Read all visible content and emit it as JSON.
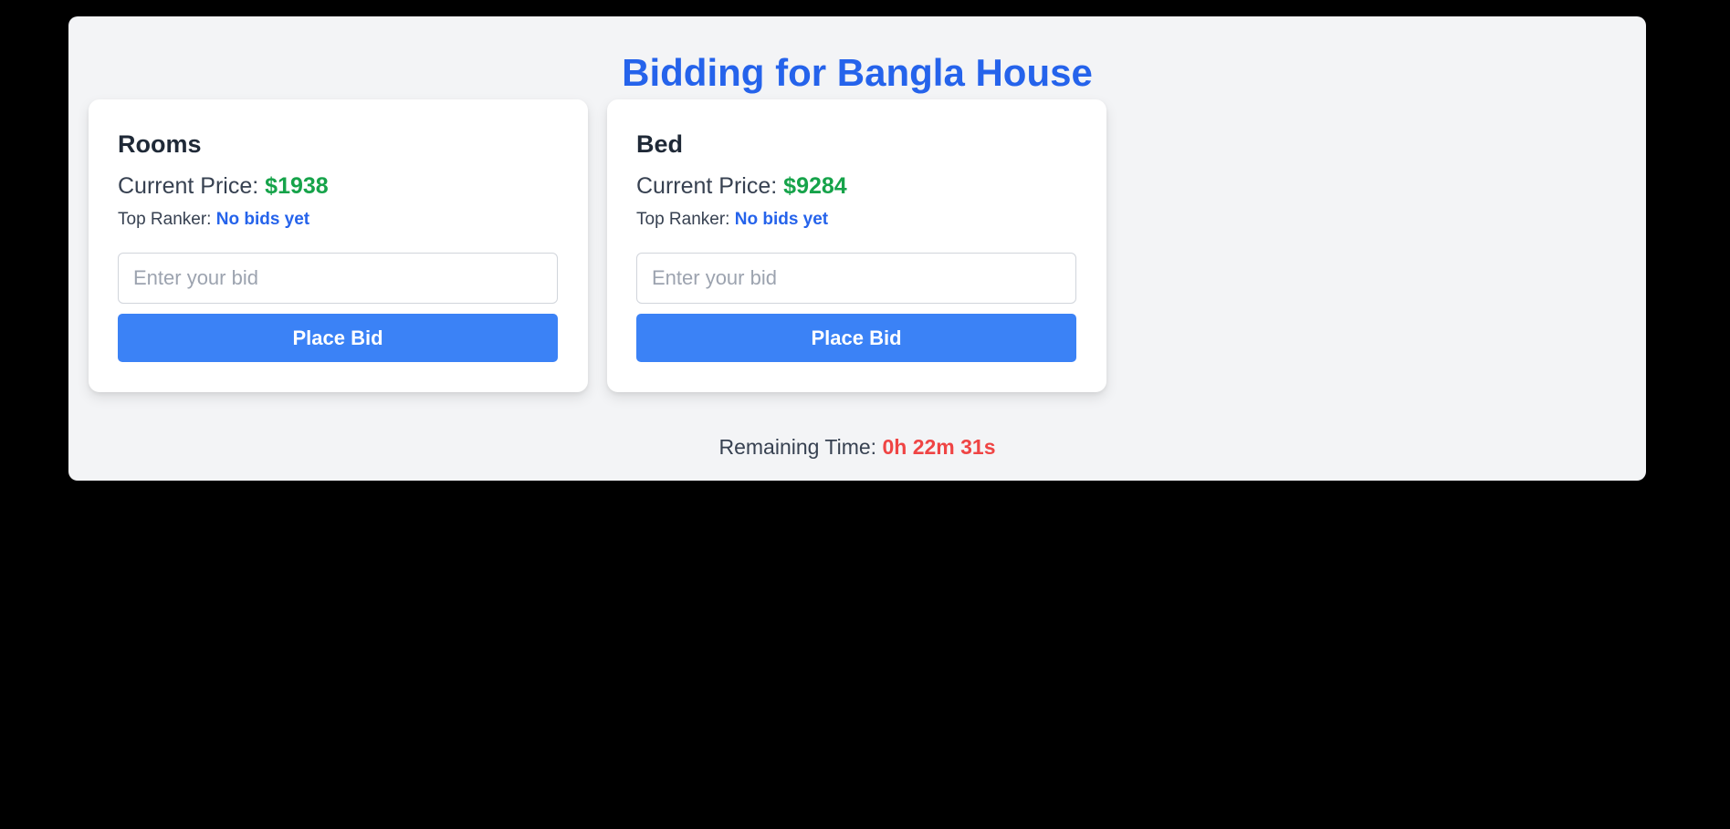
{
  "page": {
    "title": "Bidding for Bangla House"
  },
  "items": [
    {
      "name": "Rooms",
      "price_label": "Current Price: ",
      "price": "$1938",
      "ranker_label": "Top Ranker: ",
      "ranker": "No bids yet",
      "input_placeholder": "Enter your bid",
      "button_label": "Place Bid"
    },
    {
      "name": "Bed",
      "price_label": "Current Price: ",
      "price": "$9284",
      "ranker_label": "Top Ranker: ",
      "ranker": "No bids yet",
      "input_placeholder": "Enter your bid",
      "button_label": "Place Bid"
    }
  ],
  "timer": {
    "label": "Remaining Time: ",
    "value": "0h 22m 31s"
  },
  "colors": {
    "title": "#2563eb",
    "price": "#16a34a",
    "ranker": "#2563eb",
    "button": "#3b82f6",
    "timer": "#ef4444",
    "panel_background": "#f3f4f6",
    "page_background": "#000000"
  }
}
